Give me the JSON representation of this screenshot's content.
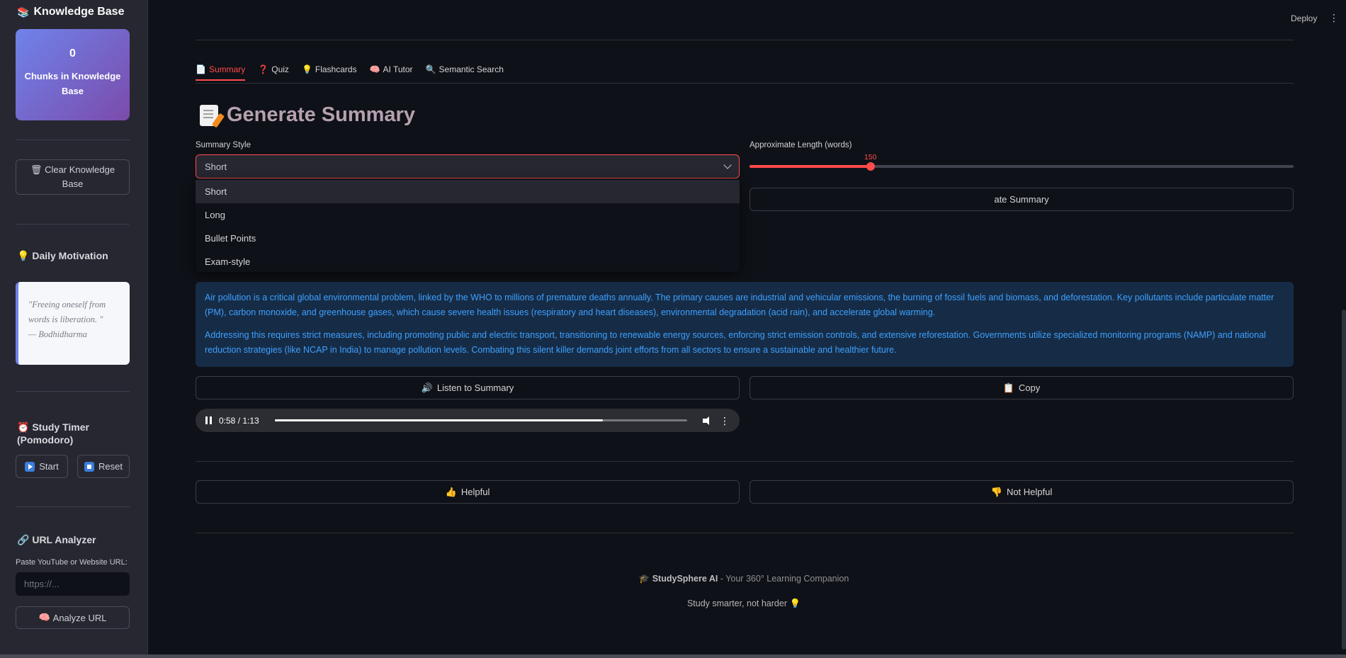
{
  "sidebar": {
    "title": "Knowledge Base",
    "kb_count": "0",
    "kb_label": "Chunks in Knowledge Base",
    "clear_label": "Clear Knowledge Base",
    "motivation_title": "Daily Motivation",
    "quote_text": "\"Freeing oneself from words is liberation. \"",
    "quote_author": "— Bodhidharma",
    "timer_title": "Study Timer (Pomodoro)",
    "start_label": "Start",
    "reset_label": "Reset",
    "url_title": "URL Analyzer",
    "url_label": "Paste YouTube or Website URL:",
    "url_placeholder": "https://...",
    "analyze_label": "Analyze URL"
  },
  "topbar": {
    "deploy": "Deploy"
  },
  "tabs": [
    {
      "label": "Summary",
      "active": true
    },
    {
      "label": "Quiz"
    },
    {
      "label": "Flashcards"
    },
    {
      "label": "AI Tutor"
    },
    {
      "label": "Semantic Search"
    }
  ],
  "main": {
    "title": "Generate Summary",
    "style_label": "Summary Style",
    "style_value": "Short",
    "style_options": [
      "Short",
      "Long",
      "Bullet Points",
      "Exam-style"
    ],
    "length_label": "Approximate Length (words)",
    "length_value": 150,
    "length_min": 50,
    "length_max": 500,
    "generate_label": "ate Summary",
    "summary_p1": "Air pollution is a critical global environmental problem, linked by the WHO to millions of premature deaths annually. The primary causes are industrial and vehicular emissions, the burning of fossil fuels and biomass, and deforestation. Key pollutants include particulate matter (PM), carbon monoxide, and greenhouse gases, which cause severe health issues (respiratory and heart diseases), environmental degradation (acid rain), and accelerate global warming.",
    "summary_p2": "Addressing this requires strict measures, including promoting public and electric transport, transitioning to renewable energy sources, enforcing strict emission controls, and extensive reforestation. Governments utilize specialized monitoring programs (NAMP) and national reduction strategies (like NCAP in India) to manage pollution levels. Combating this silent killer demands joint efforts from all sectors to ensure a sustainable and healthier future.",
    "listen_label": "Listen to Summary",
    "copy_label": "Copy",
    "audio_time": "0:58 / 1:13",
    "audio_progress": 0.795,
    "helpful_label": "Helpful",
    "not_helpful_label": "Not Helpful"
  },
  "footer": {
    "brand": "StudySphere AI",
    "brand_rest": " - Your 360° Learning Companion",
    "tagline": "Study smarter, not harder"
  },
  "colors": {
    "accent": "#ff4b4b",
    "info_text": "#3ea0ff",
    "info_bg": "#162c46"
  }
}
